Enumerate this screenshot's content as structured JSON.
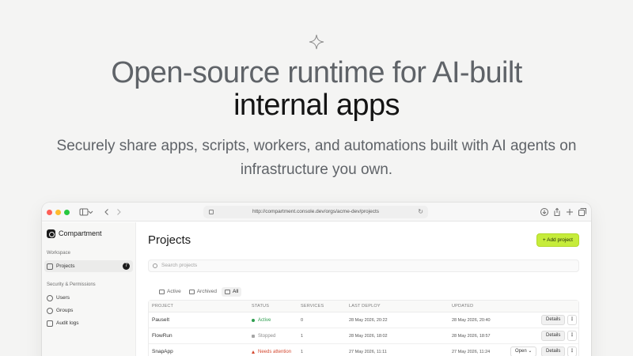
{
  "hero": {
    "icon": "sparkle-icon",
    "title_line1": "Open-source runtime for AI-built",
    "title_line2": "internal apps",
    "subtitle": "Securely share apps, scripts, workers, and automations built with AI agents on infrastructure you own."
  },
  "browser": {
    "url": "http://compartment.console.dev/orgs/acme-dev/projects"
  },
  "sidebar": {
    "brand": "Compartment",
    "workspace_label": "Workspace",
    "projects_label": "Projects",
    "projects_count": "7",
    "security_label": "Security & Permissions",
    "items": [
      {
        "label": "Users",
        "icon": "user-icon"
      },
      {
        "label": "Groups",
        "icon": "groups-icon"
      },
      {
        "label": "Audit logs",
        "icon": "list-icon"
      }
    ]
  },
  "main": {
    "title": "Projects",
    "add_button": "Add project",
    "search_placeholder": "Search projects",
    "tabs": [
      "Active",
      "Archived",
      "All"
    ],
    "active_tab": "All",
    "columns": [
      "PROJECT",
      "STATUS",
      "SERVICES",
      "LAST DEPLOY",
      "UPDATED"
    ],
    "rows": [
      {
        "project": "PauseIt",
        "status": "Active",
        "services": "0",
        "last_deploy": "28 May 2026, 20:22",
        "updated": "28 May 2026, 20:40",
        "open": "",
        "details": "Details"
      },
      {
        "project": "FlowRun",
        "status": "Stopped",
        "services": "1",
        "last_deploy": "28 May 2026, 18:02",
        "updated": "28 May 2026, 18:57",
        "open": "",
        "details": "Details"
      },
      {
        "project": "SnapApp",
        "status": "Needs attention",
        "services": "1",
        "last_deploy": "27 May 2026, 11:11",
        "updated": "27 May 2026, 11:24",
        "open": "Open",
        "details": "Details"
      }
    ]
  },
  "colors": {
    "accent": "#c6ec3b",
    "status_active": "#2e9e4f",
    "status_stopped": "#9a9a9a",
    "status_attention": "#d4472e"
  }
}
